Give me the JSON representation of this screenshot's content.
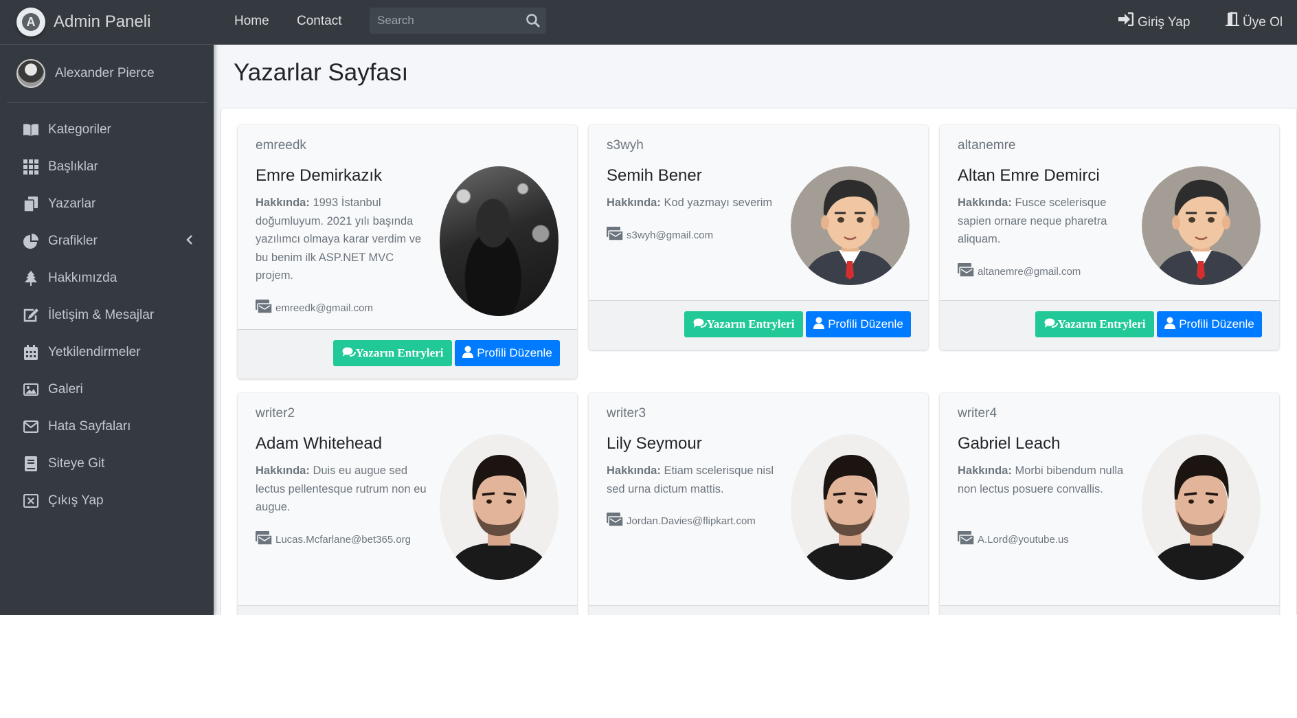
{
  "brand": {
    "title": "Admin Paneli",
    "logo_letter": "A"
  },
  "user": {
    "name": "Alexander Pierce"
  },
  "sidebar": {
    "items": [
      {
        "label": "Kategoriler",
        "icon": "book-icon"
      },
      {
        "label": "Başlıklar",
        "icon": "grid-icon"
      },
      {
        "label": "Yazarlar",
        "icon": "copy-icon"
      },
      {
        "label": "Grafikler",
        "icon": "pie-chart-icon"
      },
      {
        "label": "Hakkımızda",
        "icon": "tree-icon"
      },
      {
        "label": "İletişim & Mesajlar",
        "icon": "edit-icon"
      },
      {
        "label": "Yetkilendirmeler",
        "icon": "calendar-icon"
      },
      {
        "label": "Galeri",
        "icon": "image-icon"
      },
      {
        "label": "Hata Sayfaları",
        "icon": "envelope-icon"
      },
      {
        "label": "Siteye Git",
        "icon": "book-open-icon"
      },
      {
        "label": "Çıkış Yap",
        "icon": "close-square-icon"
      }
    ]
  },
  "topnav": {
    "home": "Home",
    "contact": "Contact",
    "search_placeholder": "Search",
    "login": "Giriş Yap",
    "register": "Üye Ol"
  },
  "page": {
    "title": "Yazarlar Sayfası"
  },
  "about_label": "Hakkında:",
  "buttons": {
    "entries": "Yazarın Entryleri",
    "edit": "Profili Düzenle"
  },
  "colors": {
    "accent_green": "#20c997",
    "accent_blue": "#007bff",
    "sidebar_bg": "#343a40"
  },
  "writers": [
    {
      "username": "emreedk",
      "name": "Emre Demirkazık",
      "about": "1993 İstanbul doğumluyum. 2021 yılı başında yazılımcı olmaya karar verdim ve bu benim ilk ASP.NET MVC projem.",
      "email": "emreedk@gmail.com",
      "photo": "photo-dark-man"
    },
    {
      "username": "s3wyh",
      "name": "Semih Bener",
      "about": "Kod yazmayı severim",
      "email": "s3wyh@gmail.com",
      "photo": "cartoon-avatar"
    },
    {
      "username": "altanemre",
      "name": "Altan Emre Demirci",
      "about": "Fusce scelerisque sapien ornare neque pharetra aliquam.",
      "email": "altanemre@gmail.com",
      "photo": "cartoon-avatar"
    },
    {
      "username": "writer2",
      "name": "Adam Whitehead",
      "about": "Duis eu augue sed lectus pellentesque rutrum non eu augue.",
      "email": "Lucas.Mcfarlane@bet365.org",
      "photo": "portrait-man"
    },
    {
      "username": "writer3",
      "name": "Lily Seymour",
      "about": "Etiam scelerisque nisl sed urna dictum mattis.",
      "email": "Jordan.Davies@flipkart.com",
      "photo": "portrait-man"
    },
    {
      "username": "writer4",
      "name": "Gabriel Leach",
      "about": "Morbi bibendum nulla non lectus posuere convallis.",
      "email": "A.Lord@youtube.us",
      "photo": "portrait-man"
    }
  ]
}
